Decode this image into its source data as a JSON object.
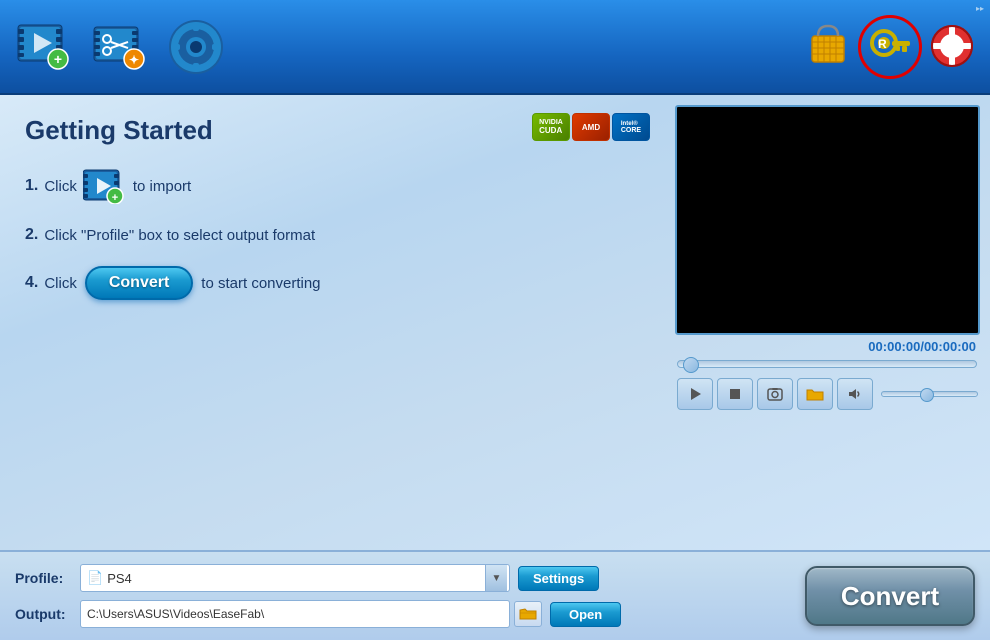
{
  "toolbar": {
    "add_video_label": "Add Video",
    "edit_label": "Edit",
    "settings_label": "Settings",
    "shop_label": "Shop",
    "key_label": "Register",
    "help_label": "Help"
  },
  "main": {
    "title": "Getting Started",
    "gpu_badges": [
      {
        "label": "CUDA",
        "sub": "NVIDIA"
      },
      {
        "label": "AMD",
        "sub": ""
      },
      {
        "label": "Intel",
        "sub": "CORE"
      }
    ],
    "steps": [
      {
        "num": "1.",
        "text_before": "Click",
        "icon": "film-add-icon",
        "text_after": "to import"
      },
      {
        "num": "2.",
        "text_before": "Click \"Profile\" box to select output format",
        "icon": "",
        "text_after": ""
      },
      {
        "num": "4.",
        "text_before": "Click",
        "btn": "Convert",
        "text_after": "to start converting"
      }
    ]
  },
  "preview": {
    "time": "00:00:00/00:00:00"
  },
  "bottom": {
    "profile_label": "Profile:",
    "profile_value": "PS4",
    "profile_icon": "📄",
    "settings_btn": "Settings",
    "output_label": "Output:",
    "output_path": "C:\\Users\\ASUS\\Videos\\EaseFab\\",
    "open_btn": "Open"
  },
  "convert_btn": "Convert"
}
